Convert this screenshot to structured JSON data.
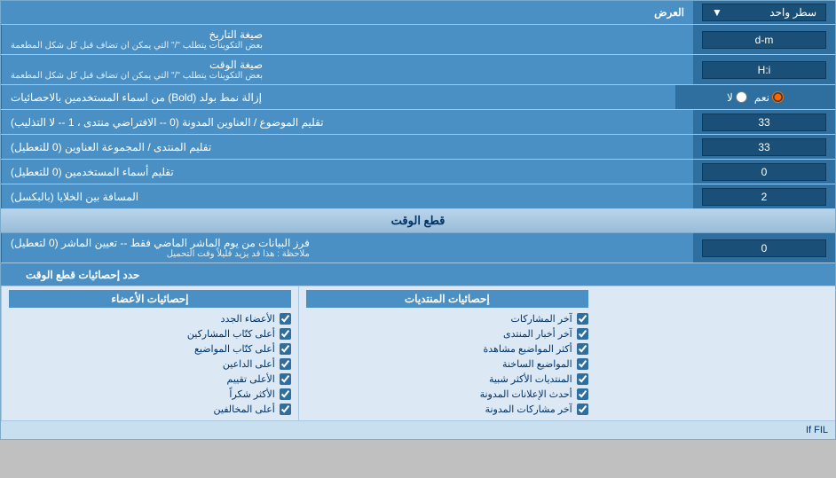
{
  "header": {
    "label_right": "العرض",
    "dropdown_label": "سطر واحد"
  },
  "rows": [
    {
      "id": "date_format",
      "label": "صيغة التاريخ",
      "sublabel": "بعض التكوينات يتطلب \"/\" التي يمكن ان تضاف قبل كل شكل المطعمة",
      "input_value": "d-m",
      "type": "text"
    },
    {
      "id": "time_format",
      "label": "صيغة الوقت",
      "sublabel": "بعض التكوينات يتطلب \"/\" التي يمكن ان تضاف قبل كل شكل المطعمة",
      "input_value": "H:i",
      "type": "text"
    },
    {
      "id": "bold_remove",
      "label": "إزالة نمط بولد (Bold) من اسماء المستخدمين بالاحصائيات",
      "type": "radio",
      "options": [
        {
          "value": "yes",
          "label": "نعم",
          "checked": true
        },
        {
          "value": "no",
          "label": "لا",
          "checked": false
        }
      ]
    },
    {
      "id": "title_order",
      "label": "تقليم الموضوع / العناوين المدونة (0 -- الافتراضي منتدى ، 1 -- لا التذليب)",
      "input_value": "33",
      "type": "text"
    },
    {
      "id": "forum_usernames",
      "label": "تقليم المنتدى / المجموعة العناوين (0 للتعطيل)",
      "input_value": "33",
      "type": "text"
    },
    {
      "id": "trim_usernames",
      "label": "تقليم أسماء المستخدمين (0 للتعطيل)",
      "input_value": "0",
      "type": "text"
    },
    {
      "id": "cell_spacing",
      "label": "المسافة بين الخلايا (بالبكسل)",
      "input_value": "2",
      "type": "text"
    }
  ],
  "section_realtime": {
    "title": "قطع الوقت"
  },
  "realtime_row": {
    "label": "فرز البيانات من يوم الماشر الماضي فقط -- تعيين الماشر (0 لتعطيل)",
    "sublabel": "ملاحظة : هذا قد يزيد قليلاً وقت التحميل",
    "input_value": "0",
    "type": "text"
  },
  "limit_section": {
    "label": "حدد إحصائيات قطع الوقت"
  },
  "checkbox_columns": [
    {
      "header": "إحصائيات الأعضاء",
      "items": [
        {
          "label": "الأعضاء الجدد",
          "checked": true
        },
        {
          "label": "أعلى كتّاب المشاركين",
          "checked": true
        },
        {
          "label": "أعلى كتّاب المواضيع",
          "checked": true
        },
        {
          "label": "أعلى الداعين",
          "checked": true
        },
        {
          "label": "الأعلى تقييم",
          "checked": true
        },
        {
          "label": "الأكثر شكراً",
          "checked": true
        },
        {
          "label": "أعلى المخالفين",
          "checked": true
        }
      ]
    },
    {
      "header": "إحصائيات المنتديات",
      "items": [
        {
          "label": "آخر المشاركات",
          "checked": true
        },
        {
          "label": "آخر أخبار المنتدى",
          "checked": true
        },
        {
          "label": "أكثر المواضيع مشاهدة",
          "checked": true
        },
        {
          "label": "المواضيع الساخنة",
          "checked": true
        },
        {
          "label": "المنتديات الأكثر شبية",
          "checked": true
        },
        {
          "label": "أحدث الإعلانات المدونة",
          "checked": true
        },
        {
          "label": "آخر مشاركات المدونة",
          "checked": true
        }
      ]
    }
  ],
  "if_fil_text": "If FIL"
}
